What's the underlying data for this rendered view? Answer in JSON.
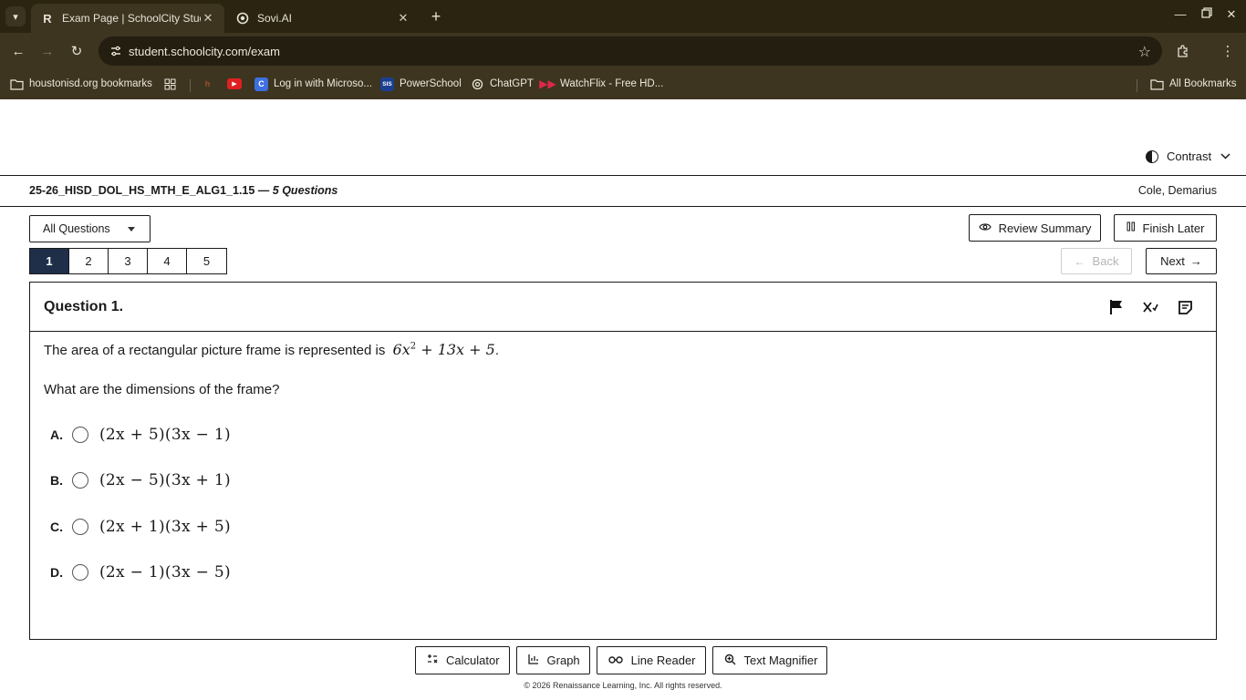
{
  "browser": {
    "tabs": [
      {
        "title": "Exam Page | SchoolCity Student",
        "active": true,
        "icon": "schoolcity-icon"
      },
      {
        "title": "Sovi.AI",
        "active": false,
        "icon": "sovi-icon"
      }
    ],
    "url": "student.schoolcity.com/exam",
    "bookmarks": [
      {
        "label": "houstonisd.org bookmarks",
        "icon": "folder-icon"
      },
      {
        "label": "",
        "icon": "apps-grid-icon"
      },
      {
        "label": "",
        "icon": "bookmark-h-icon"
      },
      {
        "label": "",
        "icon": "youtube-icon"
      },
      {
        "label": "Log in with Microso...",
        "icon": "clever-icon"
      },
      {
        "label": "PowerSchool",
        "icon": "powerschool-icon"
      },
      {
        "label": "ChatGPT",
        "icon": "chatgpt-icon"
      },
      {
        "label": "WatchFlix - Free HD...",
        "icon": "watchflix-icon"
      }
    ],
    "all_bookmarks": "All Bookmarks",
    "colors": {
      "frame": "#2a2410",
      "toolbar": "#3d3520"
    }
  },
  "page": {
    "contrast_label": "Contrast",
    "exam_title": "25-26_HISD_DOL_HS_MTH_E_ALG1_1.15 — ",
    "exam_count": "5 Questions",
    "student_name": "Cole, Demarius",
    "filter": "All Questions",
    "review_summary": "Review Summary",
    "finish_later": "Finish Later",
    "question_numbers": [
      "1",
      "2",
      "3",
      "4",
      "5"
    ],
    "current_question": "1",
    "back": "Back",
    "next": "Next",
    "accent_color": "#1f2f4a"
  },
  "question": {
    "title": "Question 1.",
    "stem": "The area of a rectangular picture frame is represented is",
    "stem_math_coef": "6x",
    "stem_math_exp": "2",
    "stem_math_tail": " + 13x + 5",
    "stem_end": ".",
    "prompt": "What are the dimensions of the frame?",
    "choices": [
      {
        "letter": "A.",
        "expr": "(2x + 5)(3x − 1)"
      },
      {
        "letter": "B.",
        "expr": "(2x − 5)(3x + 1)"
      },
      {
        "letter": "C.",
        "expr": "(2x + 1)(3x + 5)"
      },
      {
        "letter": "D.",
        "expr": "(2x − 1)(3x − 5)"
      }
    ]
  },
  "tools": {
    "calculator": "Calculator",
    "graph": "Graph",
    "line_reader": "Line Reader",
    "text_magnifier": "Text Magnifier"
  },
  "footer": {
    "copyright": "© 2026 Renaissance Learning, Inc. All rights reserved."
  }
}
